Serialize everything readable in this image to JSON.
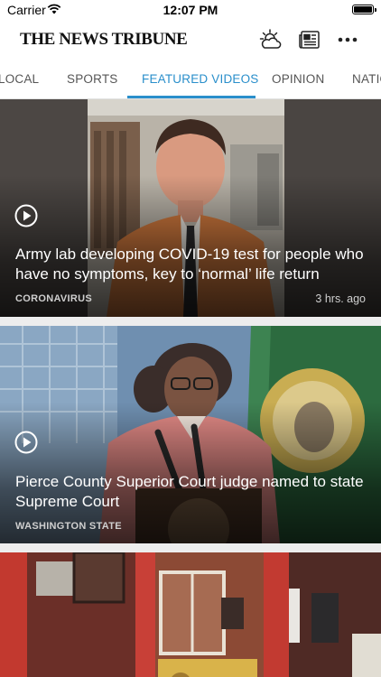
{
  "status_bar": {
    "carrier": "Carrier",
    "time": "12:07 PM"
  },
  "header": {
    "masthead": "THE NEWS TRIBUNE",
    "icons": [
      "weather-icon",
      "epaper-icon",
      "more-icon"
    ]
  },
  "tabs": [
    {
      "label": "LOCAL",
      "active": false
    },
    {
      "label": "SPORTS",
      "active": false
    },
    {
      "label": "FEATURED VIDEOS",
      "active": true
    },
    {
      "label": "OPINION",
      "active": false
    },
    {
      "label": "NATIO",
      "active": false
    }
  ],
  "colors": {
    "accent": "#2a8fcb",
    "headline_text": "#ffffff",
    "meta_text": "#cfcfcf"
  },
  "feed": {
    "items": [
      {
        "headline": "Army lab developing COVID-19 test for people who have no symptoms, key to ‘normal’ life return",
        "section": "CORONAVIRUS",
        "timestamp": "3 hrs. ago",
        "icon": "play-icon"
      },
      {
        "headline": "Pierce County Superior Court judge named to state Supreme Court",
        "section": "WASHINGTON STATE",
        "timestamp": "",
        "icon": "play-icon"
      },
      {
        "headline": "",
        "section": "",
        "timestamp": ""
      }
    ]
  }
}
